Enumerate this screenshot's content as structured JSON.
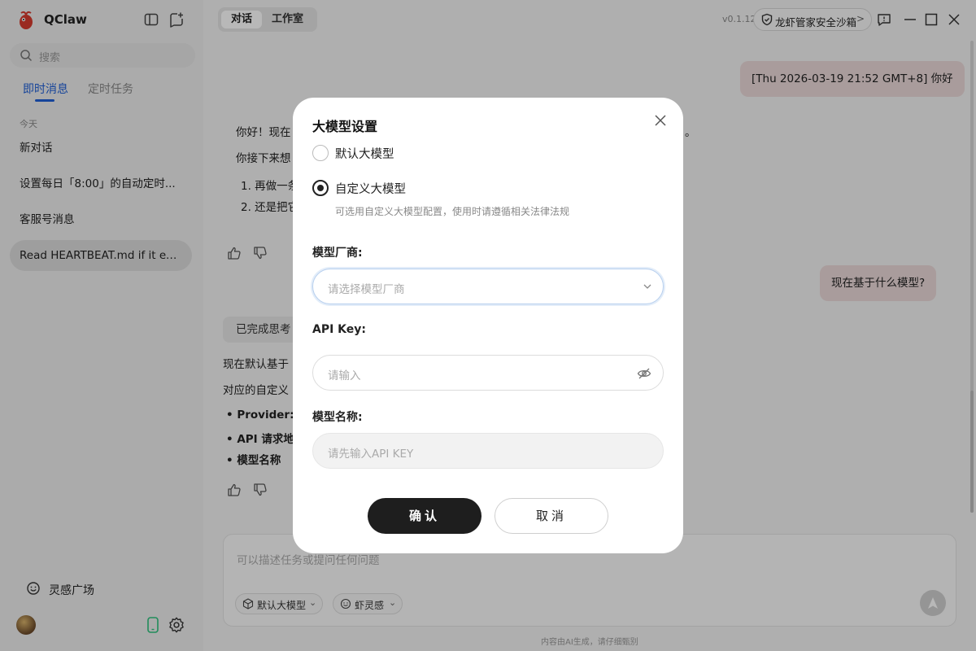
{
  "app": {
    "name": "QClaw"
  },
  "sidebar": {
    "search_placeholder": "搜索",
    "tabs": [
      {
        "label": "即时消息",
        "active": true
      },
      {
        "label": "定时任务",
        "active": false
      }
    ],
    "section_today": "今天",
    "chats": [
      {
        "label": "新对话"
      },
      {
        "label": "设置每日「8:00」的自动定时..."
      },
      {
        "label": "客服号消息"
      },
      {
        "label": "Read HEARTBEAT.md if it exists..."
      }
    ],
    "inspiration": "灵感广场"
  },
  "topbar": {
    "tabs": [
      {
        "label": "对话",
        "active": true
      },
      {
        "label": "工作室",
        "active": false
      }
    ],
    "version": "v0.1.12",
    "sandbox_label": "龙虾管家安全沙箱"
  },
  "chat": {
    "user_msg_1": "[Thu 2026-03-19 21:52 GMT+8] 你好",
    "assistant_1_line1": "你好！现在",
    "assistant_1_line1_tail": "。",
    "assistant_1_line2": "你接下来想",
    "assistant_1_item1": "1. 再做一条",
    "assistant_1_item2": "2. 还是把它",
    "user_msg_2": "现在基于什么模型?",
    "thinking_done": "已完成思考",
    "assistant_2_line1": "现在默认基于",
    "assistant_2_line2": "对应的自定义",
    "assistant_2_bullets": [
      "Provider:",
      "API 请求地",
      "模型名称"
    ]
  },
  "composer": {
    "placeholder": "可以描述任务或提问任何问题",
    "model_pill": "默认大模型",
    "skill_pill": "虾灵感"
  },
  "footer_note": "内容由AI生成，请仔细甄别",
  "modal": {
    "title": "大模型设置",
    "options": [
      {
        "label": "默认大模型",
        "selected": false
      },
      {
        "label": "自定义大模型",
        "selected": true
      }
    ],
    "custom_hint": "可选用自定义大模型配置，使用时请遵循相关法律法规",
    "vendor_label": "模型厂商:",
    "vendor_placeholder": "请选择模型厂商",
    "apikey_label": "API Key:",
    "apikey_placeholder": "请输入",
    "model_name_label": "模型名称:",
    "model_name_placeholder": "请先输入API KEY",
    "confirm_label": "确认",
    "cancel_label": "取消"
  },
  "colors": {
    "accent": "#1f5fd6",
    "user_bubble": "#ead9d8",
    "confirm_button": "#1e1e1e"
  }
}
